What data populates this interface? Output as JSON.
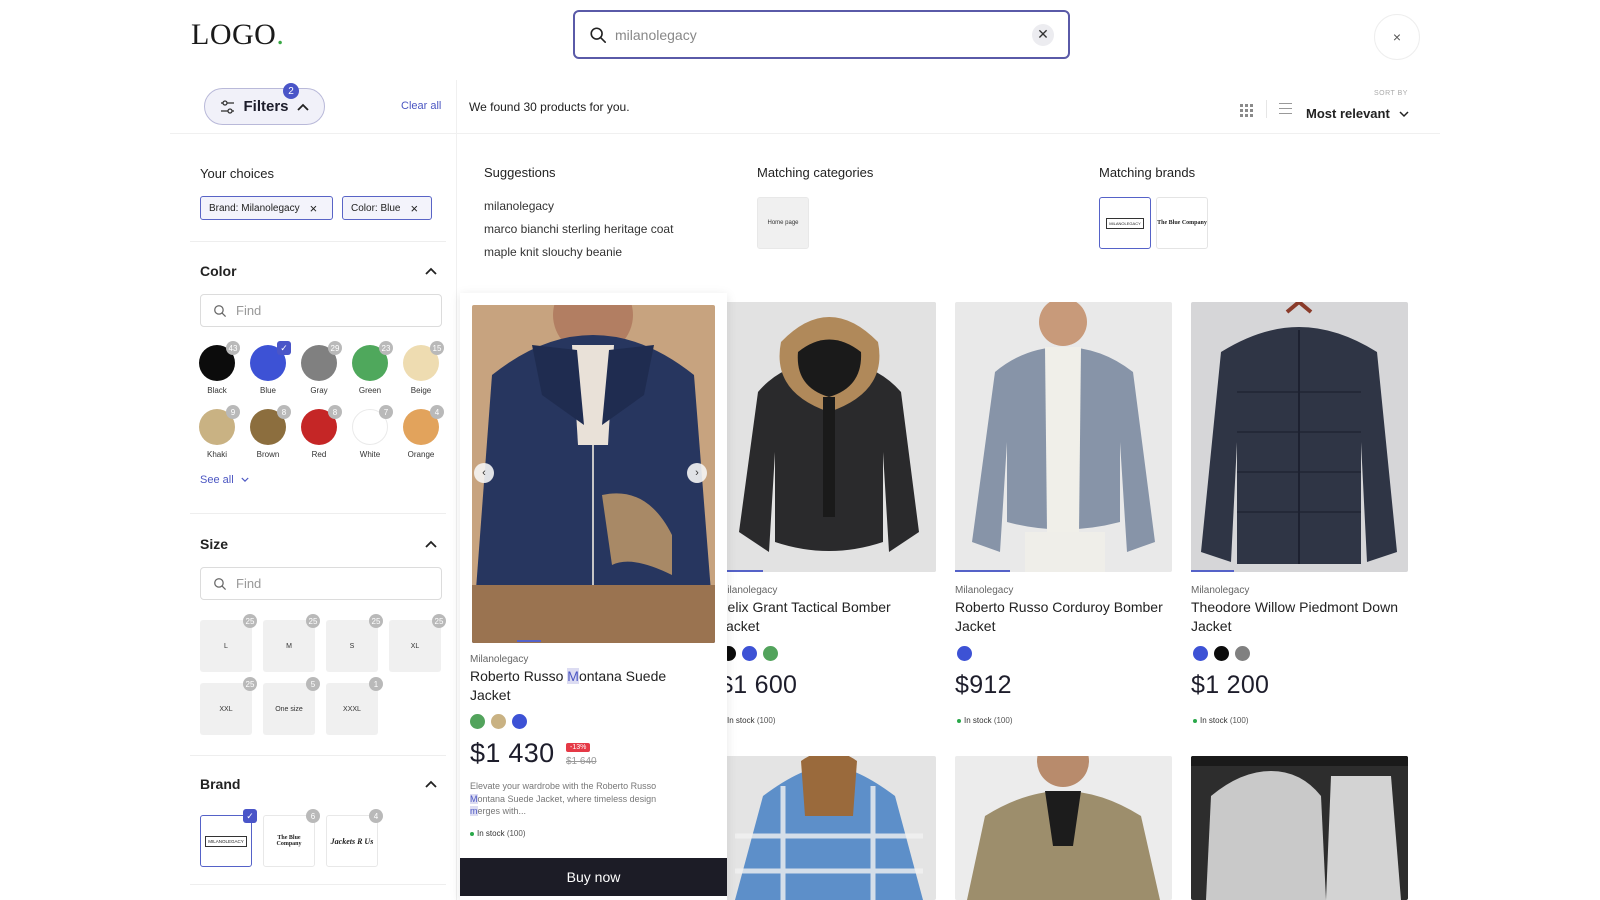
{
  "header": {
    "logo_text": "LOGO",
    "logo_dot": ".",
    "search_value": "milanolegacy",
    "clear_symbol": "✕",
    "close_symbol": "×"
  },
  "toolbar": {
    "filters_label": "Filters",
    "filters_badge": "2",
    "clear_all": "Clear all",
    "results_text": "We found 30 products for you.",
    "sort_label": "SORT BY",
    "sort_value": "Most relevant"
  },
  "sidebar": {
    "your_choices": "Your choices",
    "chips": [
      {
        "label": "Brand: Milanolegacy",
        "remove": "×"
      },
      {
        "label": "Color: Blue",
        "remove": "×"
      }
    ],
    "color": {
      "title": "Color",
      "find_placeholder": "Find",
      "swatches": [
        {
          "label": "Black",
          "count": "43",
          "color": "#0c0c0c"
        },
        {
          "label": "Blue",
          "count": "",
          "color": "#3d52d5",
          "selected": true
        },
        {
          "label": "Gray",
          "count": "29",
          "color": "#808080"
        },
        {
          "label": "Green",
          "count": "23",
          "color": "#4fa85c"
        },
        {
          "label": "Beige",
          "count": "15",
          "color": "#eedcb1"
        },
        {
          "label": "Khaki",
          "count": "9",
          "color": "#c9b283"
        },
        {
          "label": "Brown",
          "count": "8",
          "color": "#8c6e3e"
        },
        {
          "label": "Red",
          "count": "8",
          "color": "#c52626"
        },
        {
          "label": "White",
          "count": "7",
          "color": "#ffffff"
        },
        {
          "label": "Orange",
          "count": "4",
          "color": "#e2a35c"
        }
      ],
      "see_all": "See all"
    },
    "size": {
      "title": "Size",
      "find_placeholder": "Find",
      "items": [
        {
          "label": "L",
          "count": "25"
        },
        {
          "label": "M",
          "count": "25"
        },
        {
          "label": "S",
          "count": "25"
        },
        {
          "label": "XL",
          "count": "25"
        },
        {
          "label": "XXL",
          "count": "25"
        },
        {
          "label": "One size",
          "count": "5"
        },
        {
          "label": "XXXL",
          "count": "1"
        }
      ]
    },
    "brand": {
      "title": "Brand",
      "items": [
        {
          "label": "MILANOLEGACY",
          "count": "",
          "selected": true
        },
        {
          "label": "The Blue Company",
          "count": "6"
        },
        {
          "label": "Jackets R Us",
          "count": "4"
        }
      ]
    }
  },
  "suggestions": {
    "title": "Suggestions",
    "items": [
      "milanolegacy",
      "marco bianchi sterling heritage coat",
      "maple knit slouchy beanie"
    ]
  },
  "matching_categories": {
    "title": "Matching categories",
    "items": [
      "Home page"
    ]
  },
  "matching_brands": {
    "title": "Matching brands",
    "items": [
      "MILANOLEGACY",
      "The Blue Company"
    ]
  },
  "featured": {
    "brand": "Milanolegacy",
    "name_pre": "Roberto Russo ",
    "name_highlight": "M",
    "name_post": "ontana Suede Jacket",
    "colors": [
      "#52a35c",
      "#c9b283",
      "#3d52d5"
    ],
    "price": "$1 430",
    "discount": "-13%",
    "old_price": "$1 640",
    "desc_line1": "Elevate your wardrobe with the Roberto Russo",
    "desc_line2_hl": "M",
    "desc_line2": "ontana Suede Jacket, where timeless design",
    "desc_line3_hl": "m",
    "desc_line3": "erges with...",
    "stock": "In stock",
    "stock_count": "(100)",
    "buy_label": "Buy now",
    "prev_icon": "‹",
    "next_icon": "›"
  },
  "products": [
    {
      "brand": "Milanolegacy",
      "name": "Felix Grant Tactical Bomber Jacket",
      "colors": [
        "#0c0c0c",
        "#3d52d5",
        "#52a35c"
      ],
      "price": "$1 600",
      "stock": "In stock",
      "stock_count": "(100)"
    },
    {
      "brand": "Milanolegacy",
      "name": "Roberto Russo Corduroy Bomber Jacket",
      "colors": [
        "#3d52d5"
      ],
      "price": "$912",
      "stock": "In stock",
      "stock_count": "(100)"
    },
    {
      "brand": "Milanolegacy",
      "name": "Theodore Willow Piedmont Down Jacket",
      "colors": [
        "#3d52d5",
        "#0c0c0c",
        "#808080"
      ],
      "price": "$1 200",
      "stock": "In stock",
      "stock_count": "(100)"
    }
  ]
}
